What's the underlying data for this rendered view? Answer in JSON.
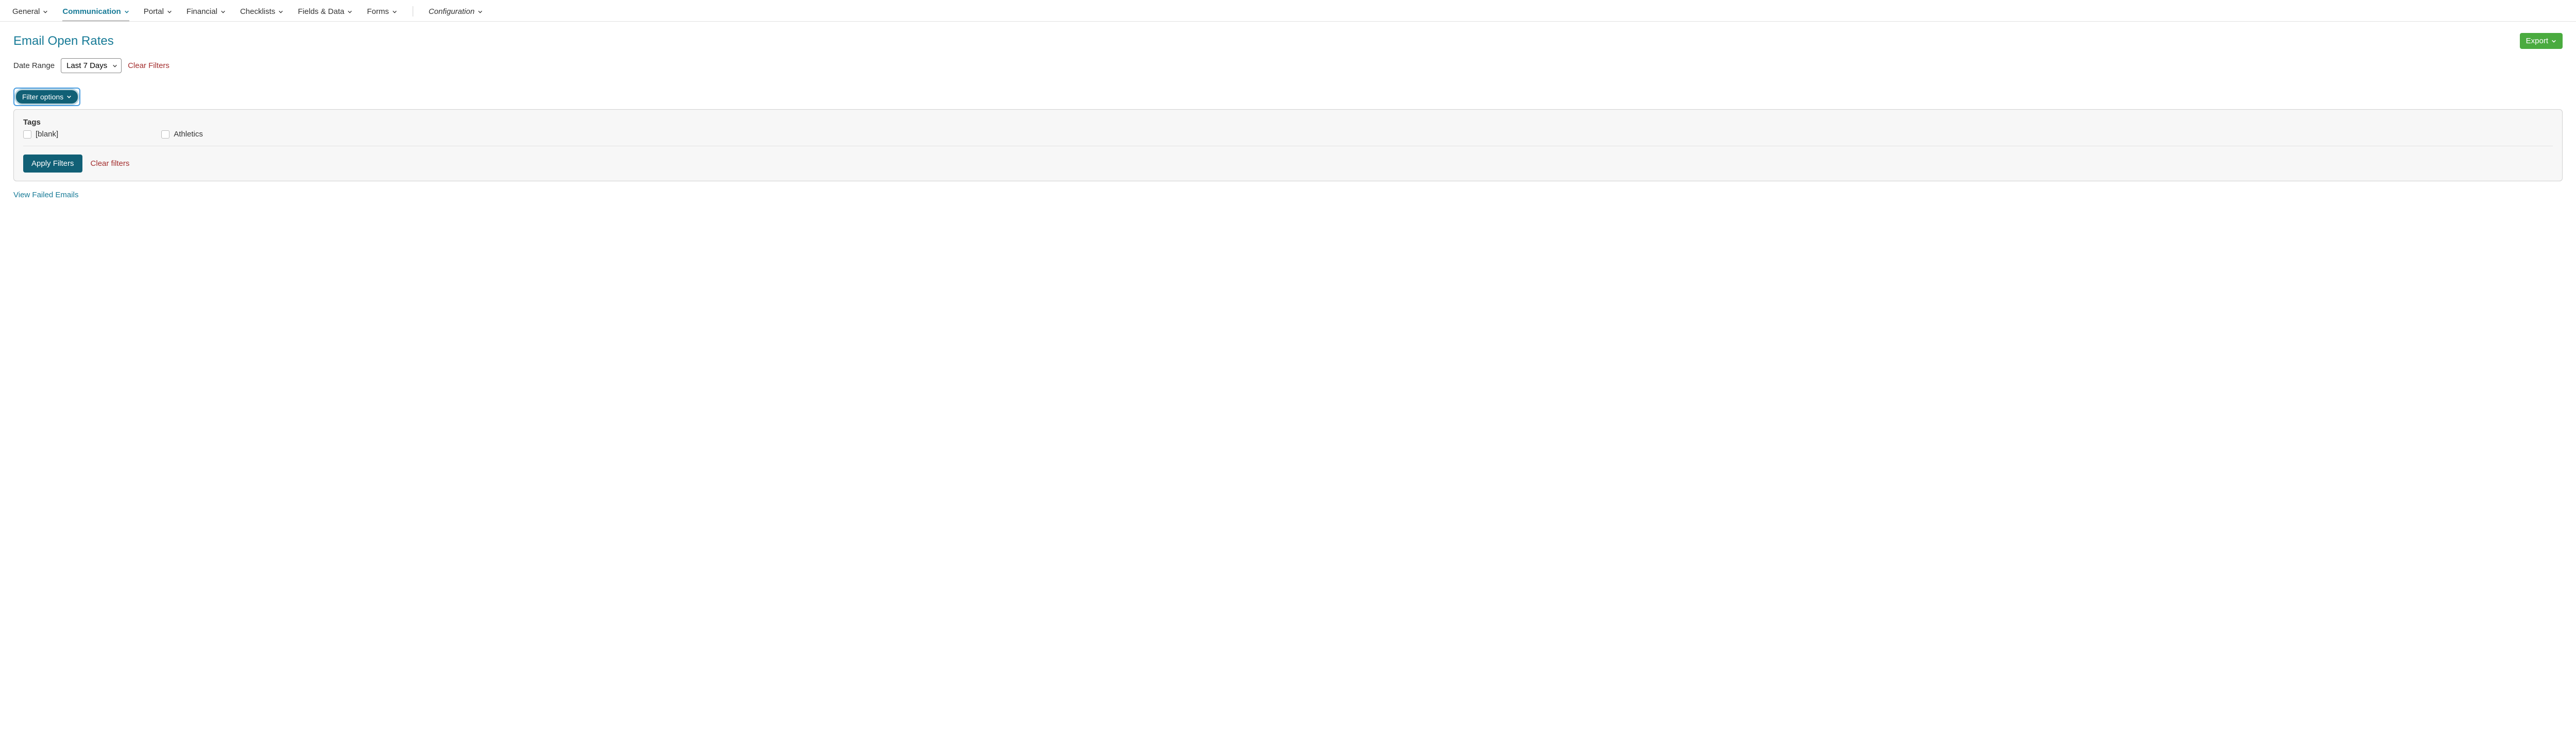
{
  "nav": {
    "items": [
      {
        "label": "General"
      },
      {
        "label": "Communication"
      },
      {
        "label": "Portal"
      },
      {
        "label": "Financial"
      },
      {
        "label": "Checklists"
      },
      {
        "label": "Fields & Data"
      },
      {
        "label": "Forms"
      }
    ],
    "config_label": "Configuration"
  },
  "page_title": "Email Open Rates",
  "export_label": "Export",
  "date_range": {
    "label": "Date Range",
    "selected": "Last 7 Days"
  },
  "clear_filters_top": "Clear Filters",
  "filter_options_label": "Filter options",
  "tags": {
    "title": "Tags",
    "options": [
      {
        "label": "[blank]"
      },
      {
        "label": "Athletics"
      }
    ]
  },
  "apply_filters_label": "Apply Filters",
  "clear_filters_panel": "Clear filters",
  "view_failed_label": "View Failed Emails"
}
